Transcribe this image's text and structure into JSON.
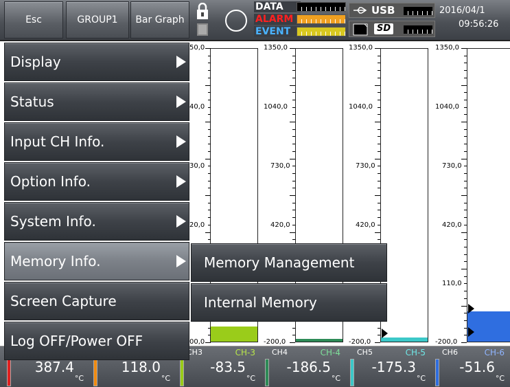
{
  "topbar": {
    "esc_label": "Esc",
    "group_label": "GROUP1",
    "view_label": "Bar Graph",
    "lock_icon": "lock-icon",
    "flags": {
      "data": "DATA",
      "alarm": "ALARM",
      "event": "EVENT"
    },
    "usb_label": "USB",
    "sd_label": "SD",
    "date": "2016/04/1",
    "time": "09:56:26",
    "colors": {
      "data": "#ffffff",
      "alarm": "#ff2020",
      "event": "#4ab3ff"
    }
  },
  "chart": {
    "columns": [
      {
        "ticks": [
          "50,0",
          "40,0",
          "30,0",
          "20,0",
          "",
          "00,0"
        ]
      },
      {
        "ticks": [
          "1350,0",
          "1040,0",
          "730,0",
          "420,0",
          "",
          "-200,0"
        ]
      },
      {
        "ticks": [
          "1350,0",
          "1040,0",
          "730,0",
          "420,0",
          "",
          "-200,0"
        ]
      },
      {
        "ticks": [
          "1350,0",
          "1040,0",
          "730,0",
          "420,0",
          "110,0",
          "-200,0"
        ]
      }
    ],
    "bar_colors": [
      "#9acc1a",
      "#2e8b57",
      "#3cc8c8",
      "#2f6ee0"
    ]
  },
  "menu": {
    "items": [
      {
        "label": "Display",
        "has_sub": true
      },
      {
        "label": "Status",
        "has_sub": true
      },
      {
        "label": "Input CH Info.",
        "has_sub": true
      },
      {
        "label": "Option Info.",
        "has_sub": true
      },
      {
        "label": "System Info.",
        "has_sub": true
      },
      {
        "label": "Memory Info.",
        "has_sub": true,
        "selected": true
      },
      {
        "label": "Screen Capture",
        "has_sub": false
      },
      {
        "label": "Log OFF/Power OFF",
        "has_sub": false
      }
    ],
    "submenu": [
      {
        "label": "Memory Management"
      },
      {
        "label": "Internal Memory"
      }
    ]
  },
  "channels": [
    {
      "id": "",
      "name": "",
      "value": "387.4",
      "unit": "°C",
      "color": "#e02020"
    },
    {
      "id": "",
      "name": "",
      "value": "118.0",
      "unit": "°C",
      "color": "#f08a10"
    },
    {
      "id": "CH3",
      "name": "CH-3",
      "value": "-83.5",
      "unit": "°C",
      "color": "#9acc1a"
    },
    {
      "id": "CH4",
      "name": "CH-4",
      "value": "-186.5",
      "unit": "°C",
      "color": "#2e8b57"
    },
    {
      "id": "CH5",
      "name": "CH-5",
      "value": "-175.3",
      "unit": "°C",
      "color": "#3cc8c8"
    },
    {
      "id": "CH6",
      "name": "CH-6",
      "value": "-51.6",
      "unit": "°C",
      "color": "#2f6ee0"
    }
  ]
}
